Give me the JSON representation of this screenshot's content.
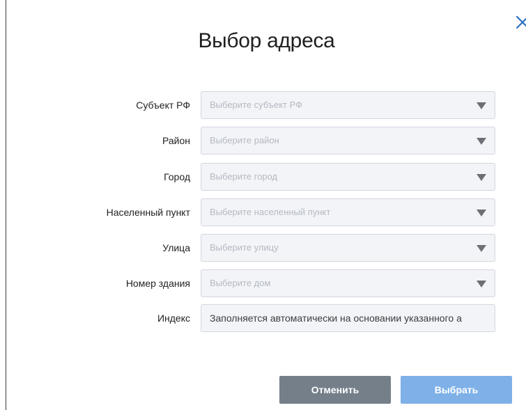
{
  "dialog": {
    "title": "Выбор адреса",
    "close_icon": "close-icon"
  },
  "form": {
    "region": {
      "label": "Субъект РФ",
      "placeholder": "Выберите субъект РФ",
      "icon": "chevron-down-icon"
    },
    "district": {
      "label": "Район",
      "placeholder": "Выберите район",
      "icon": "chevron-down-icon"
    },
    "city": {
      "label": "Город",
      "placeholder": "Выберите город",
      "icon": "chevron-down-icon"
    },
    "settlement": {
      "label": "Населенный пункт",
      "placeholder": "Выберите населенный пункт",
      "icon": "chevron-down-icon"
    },
    "street": {
      "label": "Улица",
      "placeholder": "Выберите улицу",
      "icon": "chevron-down-icon"
    },
    "building": {
      "label": "Номер здания",
      "placeholder": "Выберите дом",
      "icon": "chevron-down-icon"
    },
    "index": {
      "label": "Индекс",
      "value": "Заполняется автоматически на основании указанного а"
    }
  },
  "buttons": {
    "cancel_label": "Отменить",
    "select_label": "Выбрать"
  },
  "colors": {
    "cancel_button": "#747f8a",
    "select_button": "#7fb1e8",
    "field_background": "#f2f4f8",
    "placeholder_text": "#b4b9c1"
  }
}
